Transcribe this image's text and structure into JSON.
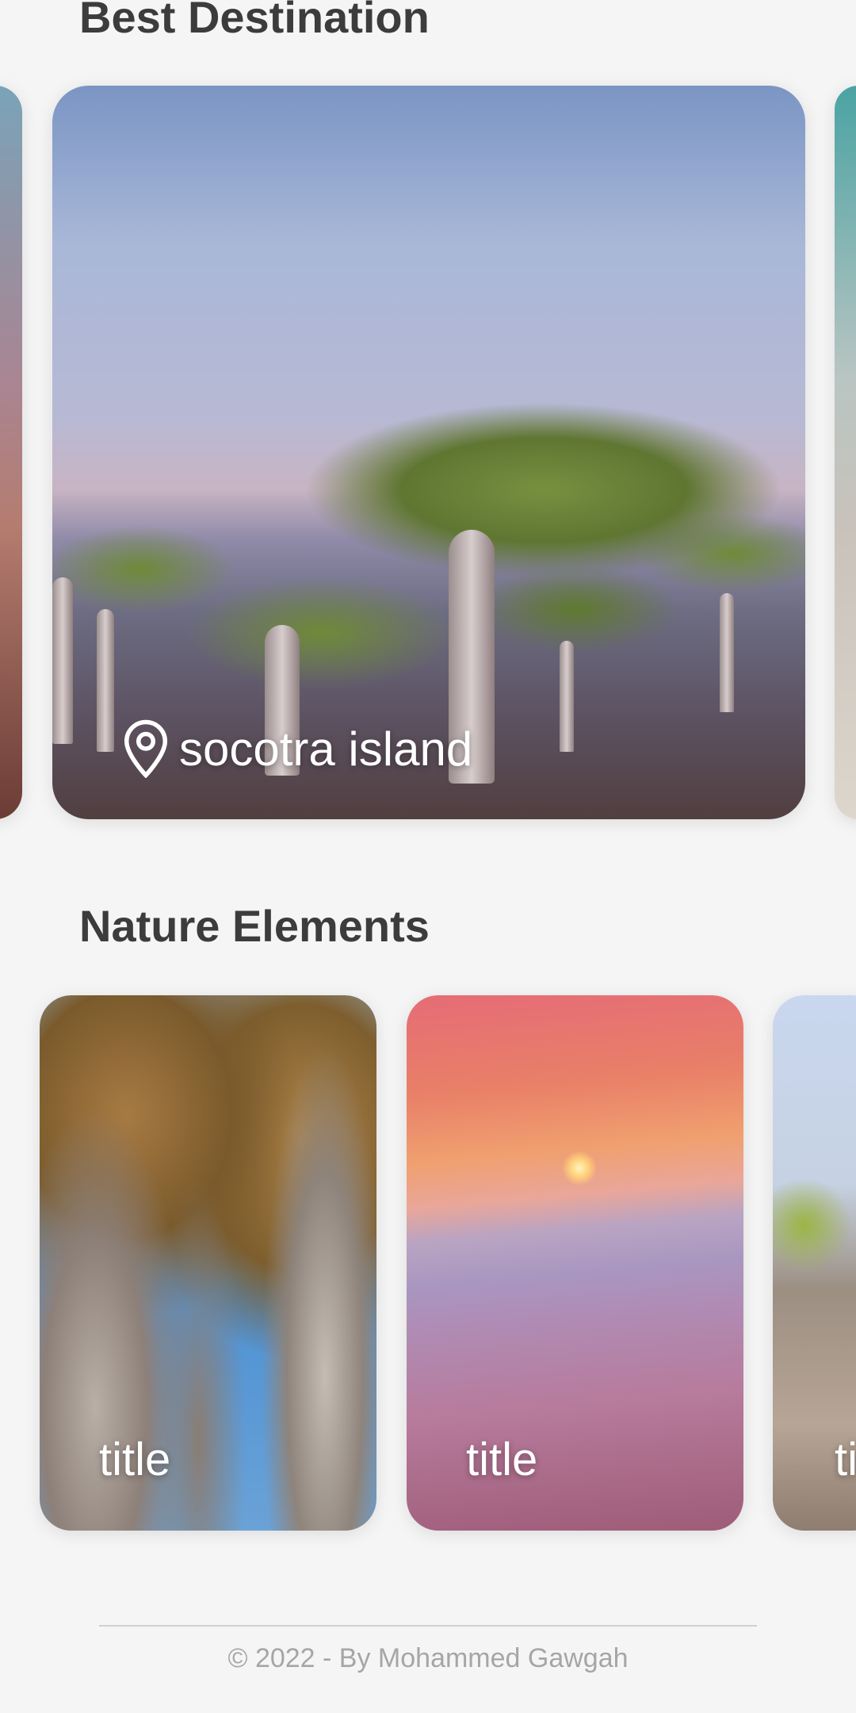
{
  "best_destination": {
    "title": "Best Destination",
    "cards": [
      {
        "location": "socotra island",
        "icon": "location-pin-icon"
      }
    ]
  },
  "nature_elements": {
    "title": "Nature Elements",
    "cards": [
      {
        "title": "title"
      },
      {
        "title": "title"
      },
      {
        "title": "title"
      }
    ]
  },
  "footer": {
    "text": "© 2022 - By Mohammed Gawgah"
  },
  "colors": {
    "background": "#f5f5f5",
    "heading": "#3c3c3c",
    "footer_text": "#a6a6a6",
    "card_text": "#ffffff"
  }
}
